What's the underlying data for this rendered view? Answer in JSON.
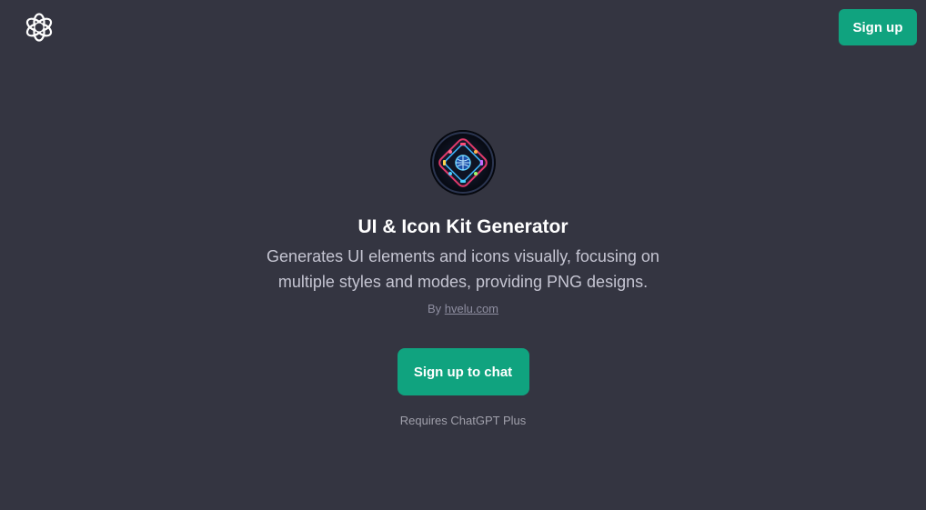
{
  "header": {
    "logo_icon": "openai-logo-icon",
    "signup_label": "Sign up"
  },
  "gpt": {
    "avatar_icon": "ui-kit-chip-icon",
    "title": "UI & Icon Kit Generator",
    "description": "Generates UI elements and icons visually, focusing on multiple styles and modes, providing PNG designs.",
    "by_prefix": "By",
    "author": "hvelu.com"
  },
  "cta": {
    "label": "Sign up to chat",
    "requirement": "Requires ChatGPT Plus"
  },
  "colors": {
    "background": "#343541",
    "accent": "#10a37f"
  }
}
